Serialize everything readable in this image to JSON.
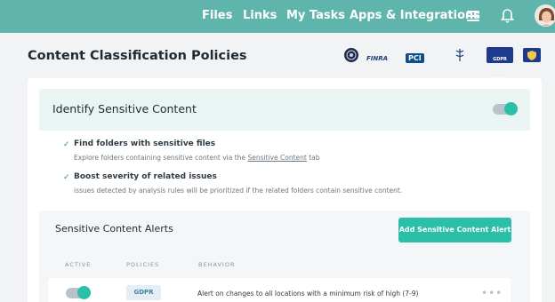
{
  "nav": {
    "files": "Files",
    "links": "Links",
    "my_tasks": "My Tasks",
    "apps": "Apps & Integrations"
  },
  "page": {
    "title": "Content Classification Policies"
  },
  "compliance_badges": [
    {
      "name": "seal-badge-icon"
    },
    {
      "label": "FINRA"
    },
    {
      "label": "PCI"
    },
    {
      "label": "HIPAA COMPLIANT"
    },
    {
      "label": "GDPR READY"
    },
    {
      "label": "shield-badge-icon"
    }
  ],
  "identify": {
    "title": "Identify Sensitive Content",
    "enabled": true
  },
  "features": [
    {
      "title": "Find folders with sensitive files",
      "desc_prefix": "Explore  folders containing sensitive content via the ",
      "desc_link": "Sensitive Content",
      "desc_suffix": " tab"
    },
    {
      "title": "Boost severity of related issues",
      "desc": "issues detected by analysis rules will be prioritized if the related folders contain sensitive content."
    }
  ],
  "alerts": {
    "title": "Sensitive Content Alerts",
    "add_button": "Add Sensitive Content Alert",
    "columns": [
      "ACTIVE",
      "POLICIES",
      "BEHAVIOR"
    ],
    "rows": [
      {
        "active": true,
        "policy": "GDPR",
        "behavior": "Alert on changes to all locations with a minimum risk of high (7-9)",
        "more": "•••"
      }
    ]
  },
  "colors": {
    "topbar": "#5fb4ab",
    "accent": "#2bbfa8",
    "identify_bg": "#eaf4f2"
  }
}
